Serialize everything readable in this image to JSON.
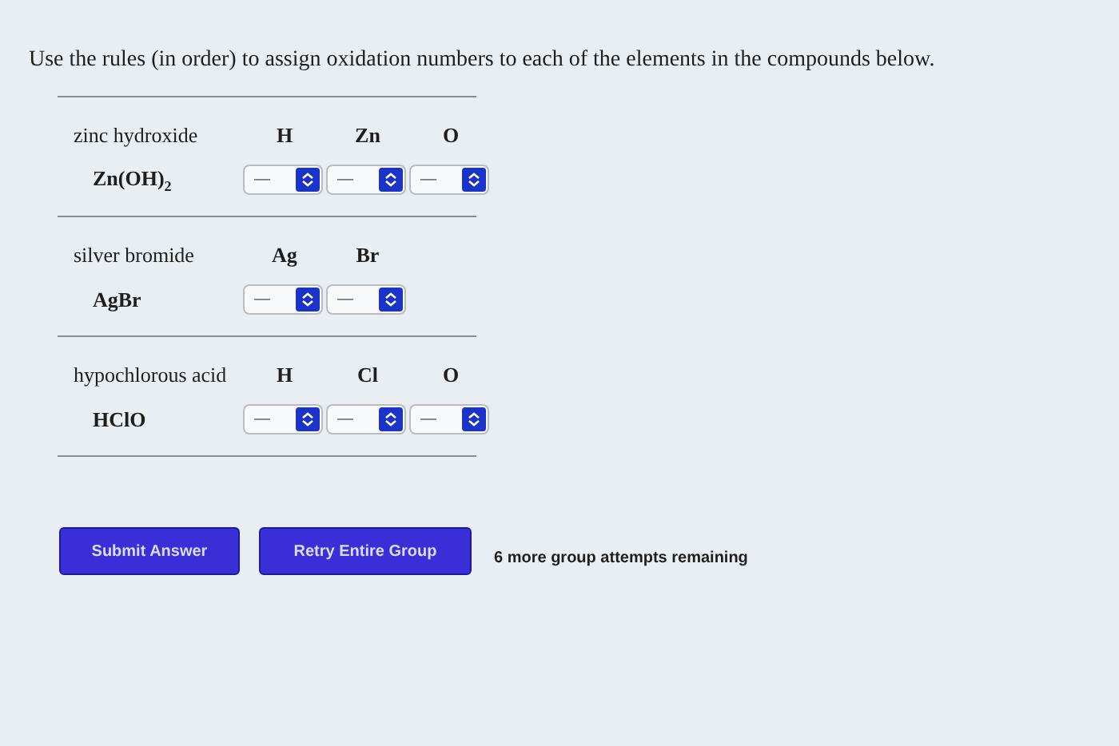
{
  "instruction": "Use the rules (in order) to assign oxidation numbers to each of the elements in the compounds below.",
  "compounds": [
    {
      "name": "zinc hydroxide",
      "formula": "Zn(OH)$_{2}$",
      "elements": [
        {
          "symbol": "H",
          "value": "—"
        },
        {
          "symbol": "Zn",
          "value": "—"
        },
        {
          "symbol": "O",
          "value": "—"
        }
      ]
    },
    {
      "name": "silver bromide",
      "formula": "AgBr",
      "elements": [
        {
          "symbol": "Ag",
          "value": "—"
        },
        {
          "symbol": "Br",
          "value": "—"
        }
      ]
    },
    {
      "name": "hypochlorous acid",
      "formula": "HClO",
      "elements": [
        {
          "symbol": "H",
          "value": "—"
        },
        {
          "symbol": "Cl",
          "value": "—"
        },
        {
          "symbol": "O",
          "value": "—"
        }
      ]
    }
  ],
  "buttons": [
    "Submit Answer",
    "Retry Entire Group"
  ],
  "attempts_note": "6 more group attempts remaining"
}
